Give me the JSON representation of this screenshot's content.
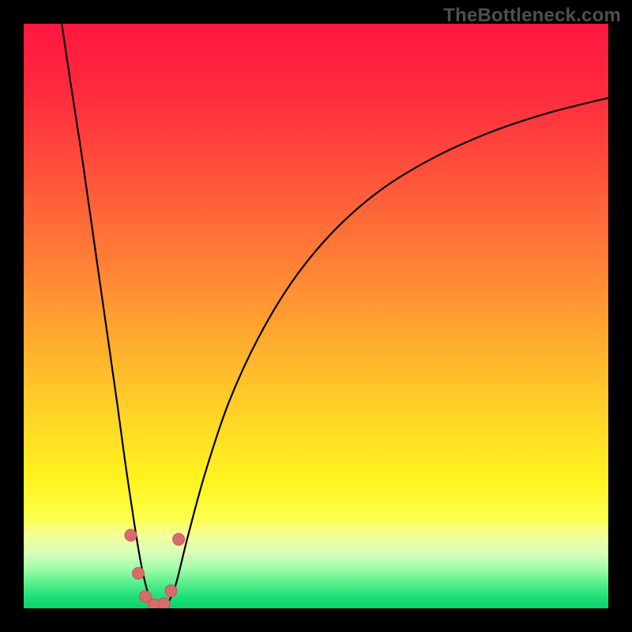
{
  "watermark": "TheBottleneck.com",
  "colors": {
    "gradient_stops": [
      {
        "offset": 0.0,
        "color": "#ff173f"
      },
      {
        "offset": 0.12,
        "color": "#ff2b3e"
      },
      {
        "offset": 0.25,
        "color": "#ff503b"
      },
      {
        "offset": 0.4,
        "color": "#ff7d36"
      },
      {
        "offset": 0.55,
        "color": "#ffae2e"
      },
      {
        "offset": 0.68,
        "color": "#ffd726"
      },
      {
        "offset": 0.78,
        "color": "#fff31f"
      },
      {
        "offset": 0.845,
        "color": "#fbff4a"
      },
      {
        "offset": 0.875,
        "color": "#f3ff9a"
      },
      {
        "offset": 0.905,
        "color": "#d8ffb8"
      },
      {
        "offset": 0.93,
        "color": "#a6fcad"
      },
      {
        "offset": 0.955,
        "color": "#5ef08e"
      },
      {
        "offset": 0.978,
        "color": "#24e07a"
      },
      {
        "offset": 1.0,
        "color": "#07d36c"
      }
    ],
    "curve": "#000000",
    "marker_fill": "#d96b6c",
    "marker_stroke": "#c65555"
  },
  "chart_data": {
    "type": "line",
    "title": "",
    "xlabel": "",
    "ylabel": "",
    "xlim": [
      0,
      100
    ],
    "ylim": [
      0,
      100
    ],
    "note": "Values are visual estimates from pixel positions; y=0 is chart bottom (green), y=100 is chart top (red). The two branches meet near x≈22, y≈0.",
    "series": [
      {
        "name": "left-branch",
        "x": [
          6.5,
          8.0,
          10.0,
          12.0,
          14.0,
          16.0,
          17.5,
          19.0,
          20.0,
          21.0,
          22.0
        ],
        "y": [
          100.0,
          90.0,
          77.0,
          63.0,
          49.0,
          35.0,
          24.0,
          14.0,
          8.0,
          3.5,
          0.5
        ]
      },
      {
        "name": "right-branch",
        "x": [
          24.5,
          26.0,
          28.0,
          31.0,
          35.0,
          40.0,
          46.0,
          53.0,
          61.0,
          70.0,
          80.0,
          90.0,
          100.0
        ],
        "y": [
          0.5,
          4.0,
          12.0,
          23.0,
          35.0,
          46.0,
          56.0,
          64.5,
          71.5,
          77.0,
          81.5,
          84.8,
          87.3
        ]
      }
    ],
    "markers": {
      "name": "highlight-points",
      "x": [
        18.3,
        19.6,
        20.8,
        22.3,
        24.0,
        25.2,
        26.5
      ],
      "y": [
        12.5,
        6.0,
        2.0,
        0.6,
        0.8,
        3.0,
        11.8
      ]
    }
  }
}
